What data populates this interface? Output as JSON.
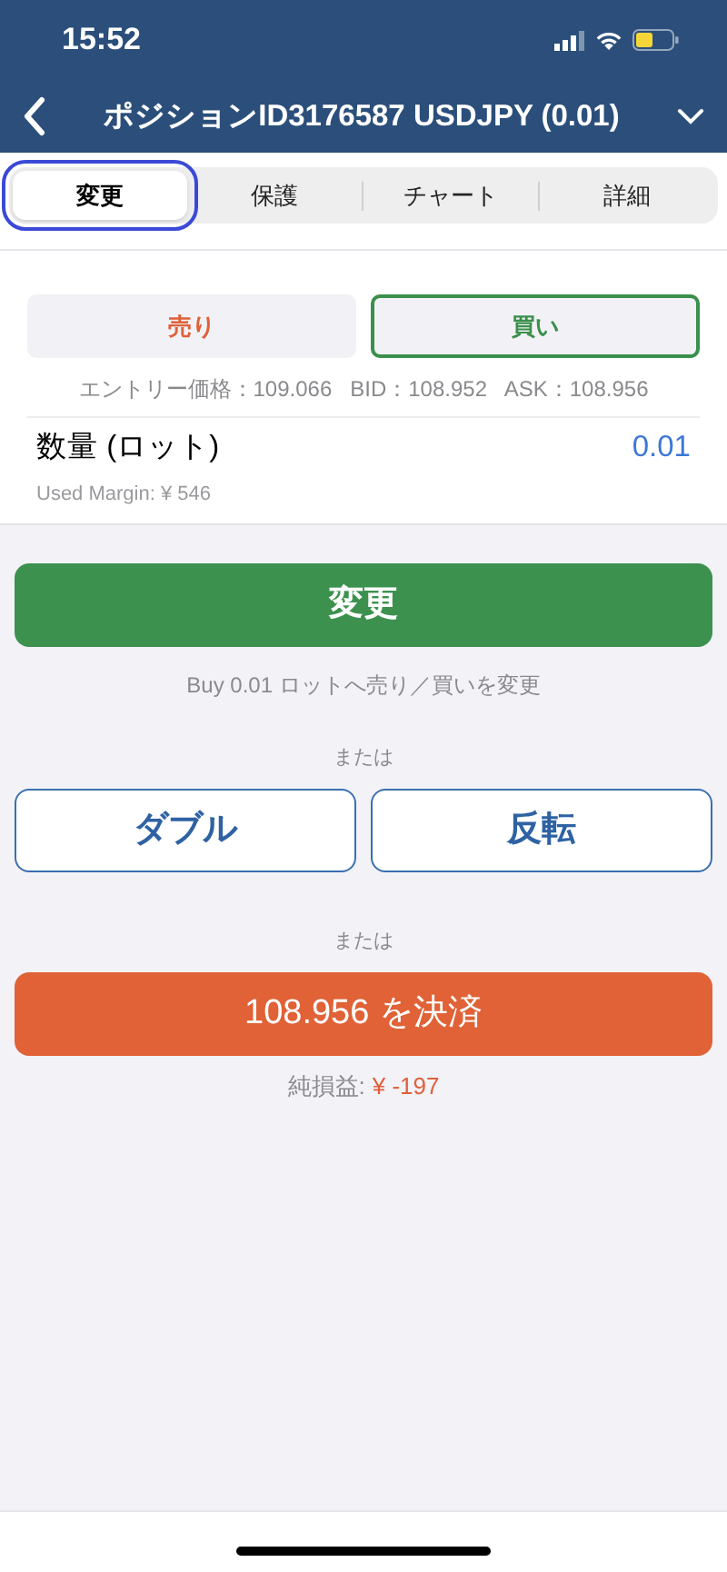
{
  "status_bar": {
    "time": "15:52"
  },
  "nav": {
    "title": "ポジションID3176587 USDJPY (0.01)"
  },
  "tabs": [
    {
      "label": "変更",
      "selected": true
    },
    {
      "label": "保護",
      "selected": false
    },
    {
      "label": "チャート",
      "selected": false
    },
    {
      "label": "詳細",
      "selected": false
    }
  ],
  "sides": [
    {
      "label": "売り",
      "kind": "sell",
      "selected": false
    },
    {
      "label": "買い",
      "kind": "buy",
      "selected": true
    }
  ],
  "price_info": "エントリー価格：109.066   BID：108.952   ASK：108.956",
  "quantity": {
    "label": "数量 (ロット)",
    "value": "0.01",
    "margin": "Used Margin: ¥ 546"
  },
  "modify_button": "変更",
  "modify_caption": "Buy 0.01 ロットへ売り／買いを変更",
  "or_1": "または",
  "alt_buttons": [
    "ダブル",
    "反転"
  ],
  "or_2": "または",
  "close_button": "108.956 を決済",
  "pnl": {
    "label": "純損益:",
    "value": "¥ -197"
  }
}
